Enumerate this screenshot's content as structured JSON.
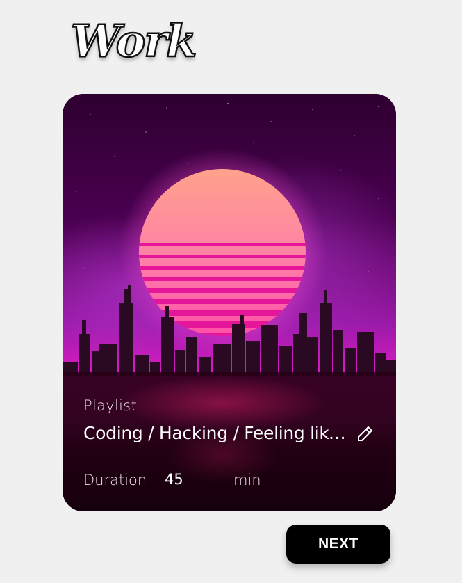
{
  "header": {
    "title": "Work"
  },
  "card": {
    "playlist_label": "Playlist",
    "playlist_value": "Coding / Hacking / Feeling like a hacker",
    "duration_label": "Duration",
    "duration_value": "45",
    "duration_unit": "min"
  },
  "actions": {
    "next_label": "NEXT"
  },
  "icons": {
    "edit": "pencil-edit-icon"
  },
  "colors": {
    "background": "#f0f0f0",
    "sun_top": "#ffa08a",
    "sun_bottom": "#ff3aa0",
    "sky_mid": "#8a1a9a",
    "horizon_glow": "#ff1fc8",
    "button": "#000000"
  }
}
